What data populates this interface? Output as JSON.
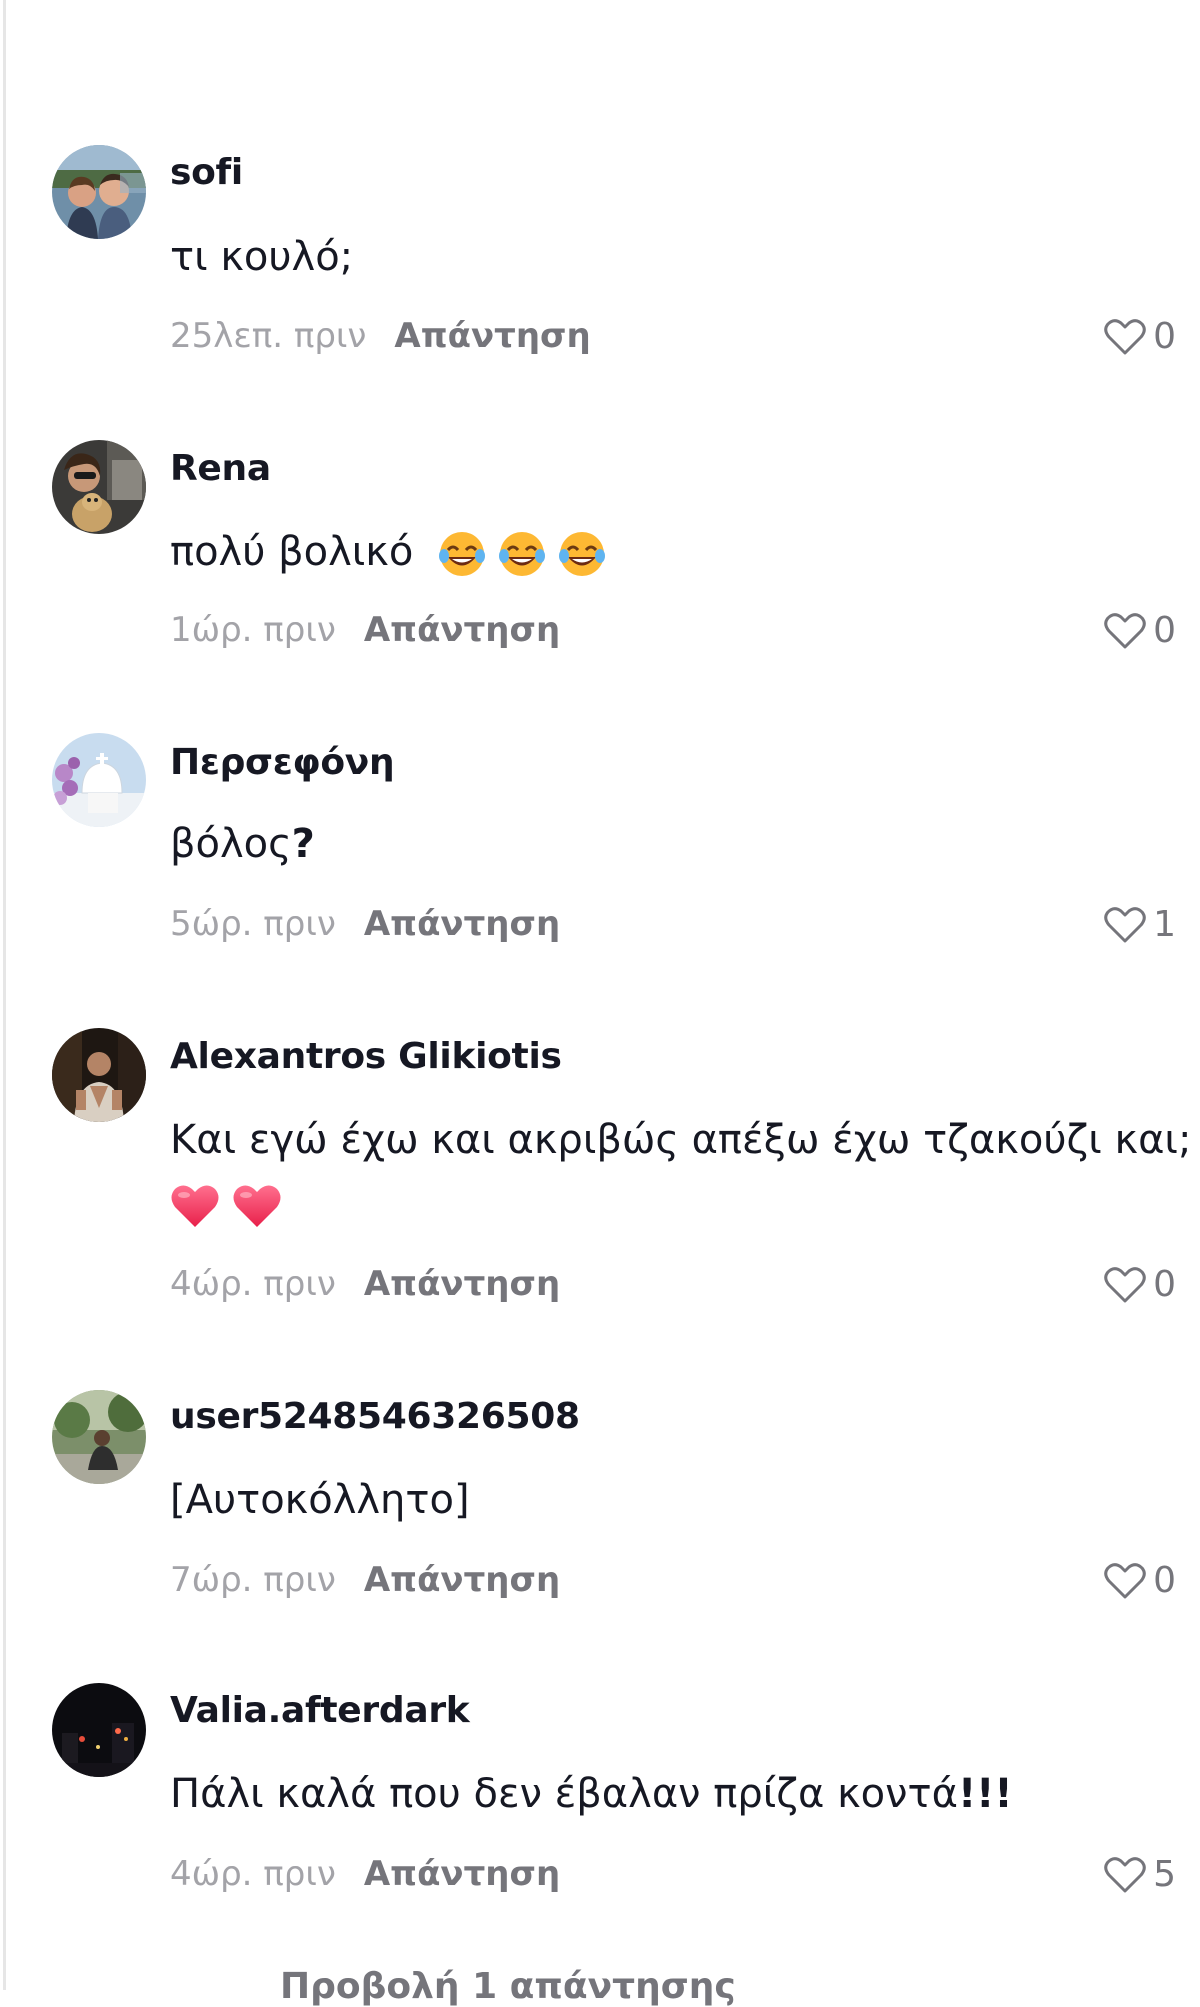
{
  "comments": [
    {
      "username": "sofi",
      "text": "τι κουλό;",
      "time": "25λεπ. πριν",
      "reply_label": "Απάντηση",
      "likes": "0",
      "avatar_icon": "couple-photo-avatar"
    },
    {
      "username": "Rena",
      "text": "πολύ βολικό",
      "emojis": [
        "face-with-tears-of-joy",
        "face-with-tears-of-joy",
        "face-with-tears-of-joy"
      ],
      "time": "1ώρ. πριν",
      "reply_label": "Απάντηση",
      "likes": "0",
      "avatar_icon": "selfie-with-dog-avatar"
    },
    {
      "username": "Περσεφόνη",
      "text": "βόλος",
      "text_suffix": "?",
      "time": "5ώρ. πριν",
      "reply_label": "Απάντηση",
      "likes": "1",
      "avatar_icon": "santorini-church-avatar"
    },
    {
      "username": "Alexantros Glikiotis",
      "text": "Και εγώ έχω και ακριβώς απέξω έχω τζακούζι και;",
      "emojis": [
        "red-heart",
        "red-heart"
      ],
      "time": "4ώρ. πριν",
      "reply_label": "Απάντηση",
      "likes": "0",
      "avatar_icon": "man-dark-room-avatar"
    },
    {
      "username": "user5248546326508",
      "text": "[Αυτοκόλλητο]",
      "time": "7ώρ. πριν",
      "reply_label": "Απάντηση",
      "likes": "0",
      "avatar_icon": "garden-photo-avatar"
    },
    {
      "username": "Valia.afterdark",
      "text": "Πάλι καλά που δεν έβαλαν πρίζα κοντά",
      "text_suffix": "!!!",
      "time": "4ώρ. πριν",
      "reply_label": "Απάντηση",
      "likes": "5",
      "avatar_icon": "night-city-avatar"
    }
  ],
  "view_more": "Προβολή 1 απάντησης",
  "colors": {
    "text": "#161823",
    "muted": "#a3a3a8",
    "secondary": "#75757b",
    "heart_emoji": "#f0305a"
  }
}
